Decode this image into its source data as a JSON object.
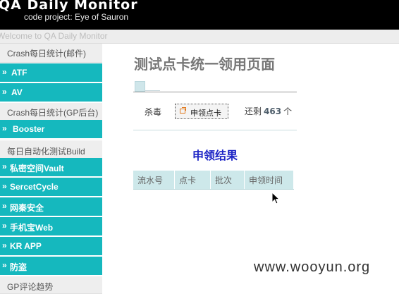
{
  "header": {
    "title": "QA Daily Monitor",
    "subtitle": "code project: Eye of Sauron"
  },
  "welcome": "Welcome to QA Daily Monitor",
  "sidebar": {
    "sections": [
      {
        "header": "Crash每日统计(邮件)",
        "items": [
          "ATF",
          "AV"
        ]
      },
      {
        "header": "Crash每日统计(GP后台)",
        "items": [
          "Booster"
        ]
      },
      {
        "header": "每日自动化测试Build",
        "items": [
          "私密空间Vault",
          "SercetCycle",
          "网秦安全",
          "手机宝Web",
          "KR APP",
          "防盗"
        ]
      },
      {
        "header": "GP评论趋势",
        "items": []
      }
    ],
    "arrow": "»"
  },
  "main": {
    "page_title": "测试点卡统一领用页面",
    "antivirus_label": "杀毒",
    "claim_button_label": "申领点卡",
    "remaining_prefix": "还剩",
    "remaining_count": "463",
    "remaining_unit": "个",
    "results_heading": "申领结果",
    "table_headers": [
      "流水号",
      "点卡",
      "批次",
      "申领时间"
    ]
  },
  "watermark": "www.wooyun.org",
  "colors": {
    "header_bg": "#000000",
    "sidebar_item_bg": "#15b8be",
    "results_heading": "#1e26c6",
    "table_header_bg": "#cde8ea"
  },
  "icons": {
    "claim_button_icon": "external-window-icon",
    "cursor": "mouse-pointer-icon"
  }
}
